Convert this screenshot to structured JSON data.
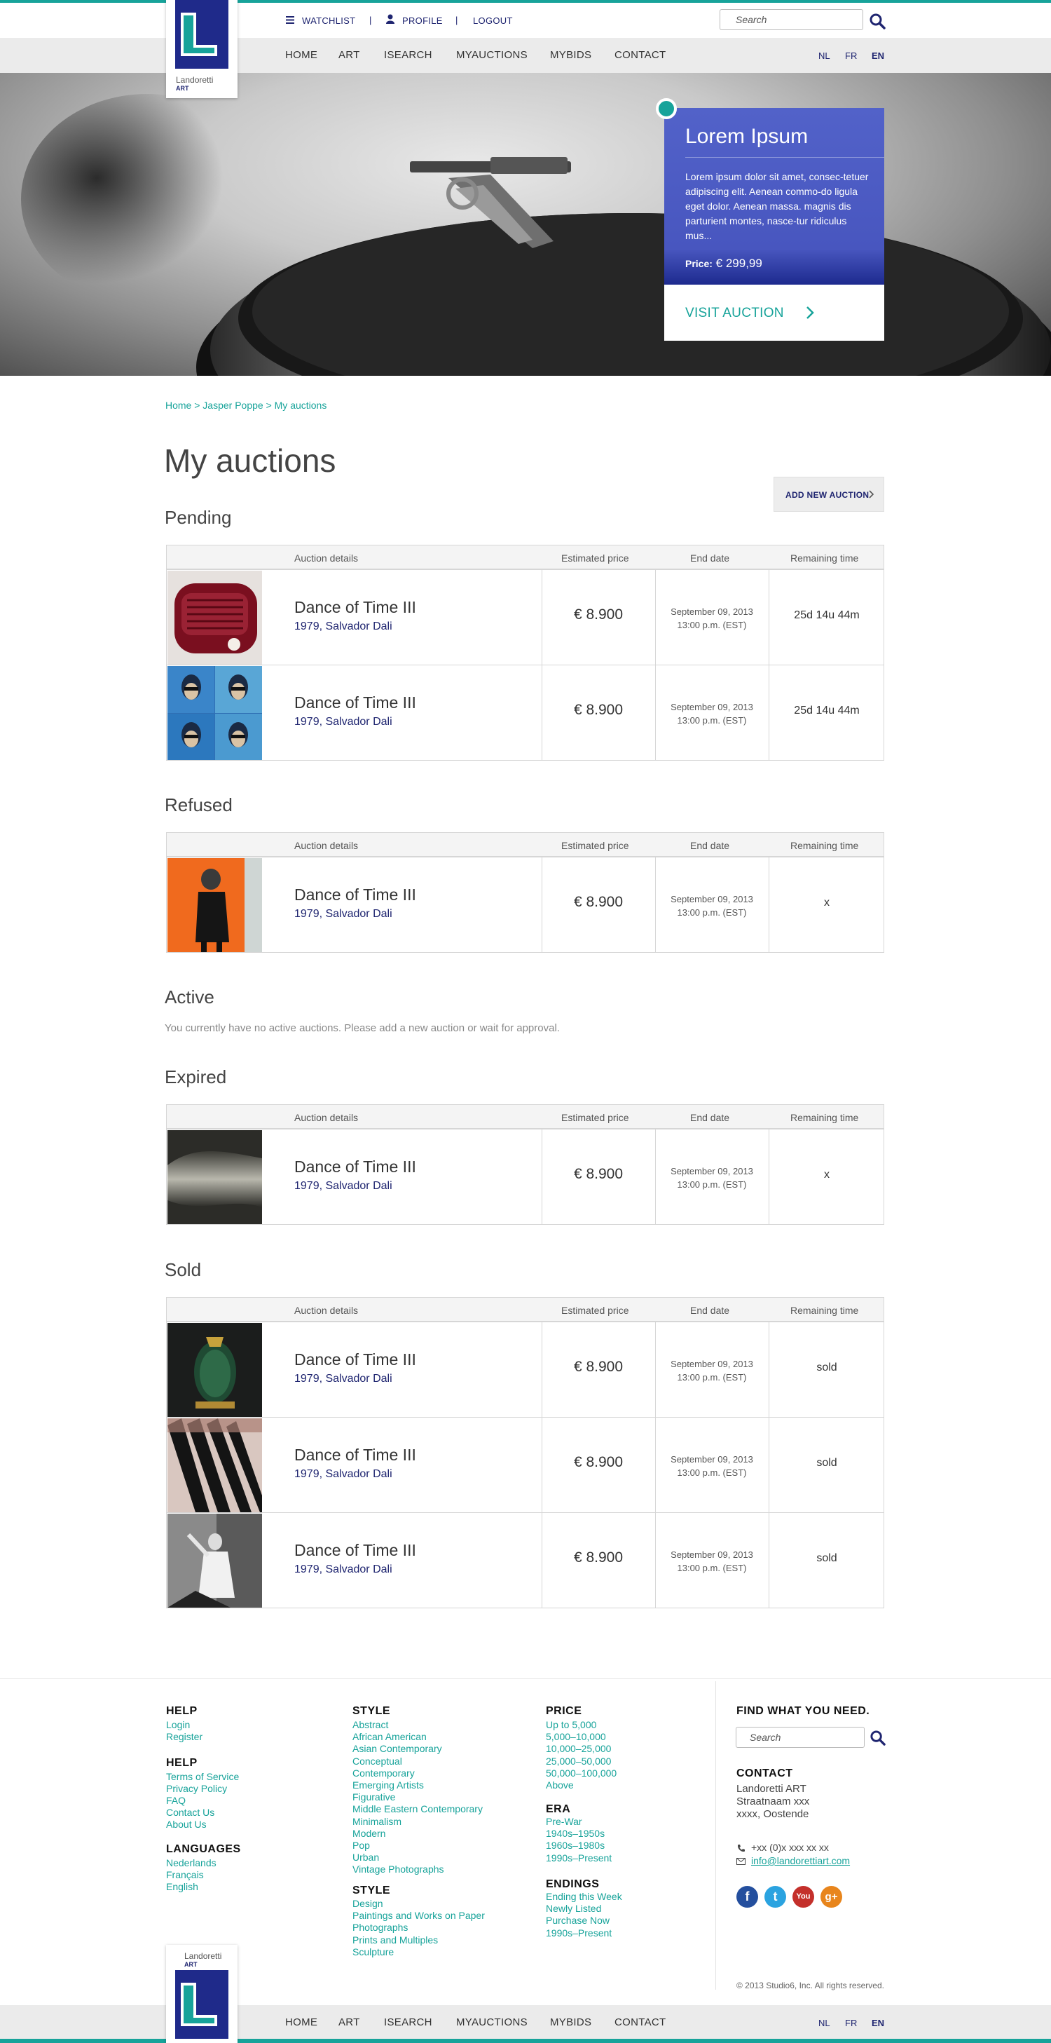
{
  "brand": {
    "name": "Landoretti",
    "sub": "ART"
  },
  "header": {
    "watchlist": "WATCHLIST",
    "profile": "PROFILE",
    "logout": "LOGOUT",
    "separator": "|",
    "search_placeholder": "Search",
    "nav": [
      "HOME",
      "ART",
      "ISEARCH",
      "MYAUCTIONS",
      "MYBIDS",
      "CONTACT"
    ],
    "languages": [
      "NL",
      "FR",
      "EN"
    ],
    "active_language": "EN"
  },
  "hero": {
    "title": "Lorem Ipsum",
    "body": "Lorem ipsum dolor sit amet, consec-tetuer adipiscing elit. Aenean commo-do ligula eget dolor. Aenean massa. magnis dis parturient montes, nasce-tur ridiculus mus...",
    "price_label": "Price:",
    "price_value": "€ 299,99",
    "cta": "VISIT AUCTION"
  },
  "breadcrumb": "Home > Jasper Poppe > My auctions",
  "page_title": "My auctions",
  "add_button": "ADD NEW AUCTION",
  "table_headers": {
    "details": "Auction details",
    "price": "Estimated price",
    "end": "End date",
    "remaining": "Remaining time"
  },
  "sections": {
    "pending": {
      "title": "Pending",
      "rows": [
        {
          "title": "Dance of Time III",
          "sub": "1979, Salvador Dali",
          "price": "€ 8.900",
          "date1": "September 09, 2013",
          "date2": "13:00 p.m. (EST)",
          "remaining": "25d 14u 44m"
        },
        {
          "title": "Dance of Time III",
          "sub": "1979, Salvador Dali",
          "price": "€ 8.900",
          "date1": "September 09, 2013",
          "date2": "13:00 p.m. (EST)",
          "remaining": "25d 14u 44m"
        }
      ]
    },
    "refused": {
      "title": "Refused",
      "rows": [
        {
          "title": "Dance of Time III",
          "sub": "1979, Salvador Dali",
          "price": "€ 8.900",
          "date1": "September 09, 2013",
          "date2": "13:00 p.m. (EST)",
          "remaining": "x"
        }
      ]
    },
    "active": {
      "title": "Active",
      "empty": "You currently have no active auctions. Please add a new auction or wait for approval."
    },
    "expired": {
      "title": "Expired",
      "rows": [
        {
          "title": "Dance of Time III",
          "sub": "1979, Salvador Dali",
          "price": "€ 8.900",
          "date1": "September 09, 2013",
          "date2": "13:00 p.m. (EST)",
          "remaining": "x"
        }
      ]
    },
    "sold": {
      "title": "Sold",
      "rows": [
        {
          "title": "Dance of Time III",
          "sub": "1979, Salvador Dali",
          "price": "€ 8.900",
          "date1": "September 09, 2013",
          "date2": "13:00 p.m. (EST)",
          "remaining": "sold"
        },
        {
          "title": "Dance of Time III",
          "sub": "1979, Salvador Dali",
          "price": "€ 8.900",
          "date1": "September 09, 2013",
          "date2": "13:00 p.m. (EST)",
          "remaining": "sold"
        },
        {
          "title": "Dance of Time III",
          "sub": "1979, Salvador Dali",
          "price": "€ 8.900",
          "date1": "September 09, 2013",
          "date2": "13:00 p.m. (EST)",
          "remaining": "sold"
        }
      ]
    }
  },
  "footer": {
    "help1": {
      "title": "HELP",
      "links": [
        "Login",
        "Register"
      ]
    },
    "help2": {
      "title": "HELP",
      "links": [
        "Terms of Service",
        "Privacy Policy",
        "FAQ",
        "Contact Us",
        "About Us"
      ]
    },
    "languages": {
      "title": "LANGUAGES",
      "links": [
        "Nederlands",
        "Français",
        "English"
      ]
    },
    "style1": {
      "title": "STYLE",
      "links": [
        "Abstract",
        "African American",
        "Asian Contemporary",
        "Conceptual",
        "Contemporary",
        "Emerging Artists",
        "Figurative",
        "Middle Eastern Contemporary",
        "Minimalism",
        "Modern",
        "Pop",
        "Urban",
        "Vintage Photographs"
      ]
    },
    "style2": {
      "title": "STYLE",
      "links": [
        "Design",
        "Paintings and Works on Paper",
        "Photographs",
        "Prints and Multiples",
        "Sculpture"
      ]
    },
    "price": {
      "title": "PRICE",
      "links": [
        "Up to 5,000",
        "5,000–10,000",
        "10,000–25,000",
        "25,000–50,000",
        "50,000–100,000",
        "Above"
      ]
    },
    "era": {
      "title": "ERA",
      "links": [
        "Pre-War",
        "1940s–1950s",
        "1960s–1980s",
        "1990s–Present"
      ]
    },
    "endings": {
      "title": "ENDINGS",
      "links": [
        "Ending this Week",
        "Newly Listed",
        "Purchase Now",
        "1990s–Present"
      ]
    },
    "find_title": "FIND WHAT YOU NEED.",
    "search_placeholder": "Search",
    "contact_title": "CONTACT",
    "contact_lines": [
      "Landoretti ART",
      "Straatnaam xxx",
      "xxxx, Oostende"
    ],
    "phone": "+xx (0)x xxx xx xx",
    "email": "info@landorettiart.com",
    "social": [
      "f",
      "t",
      "You",
      "g+"
    ],
    "copyright": "© 2013 Studio6, Inc. All rights reserved."
  },
  "colors": {
    "accent": "#17a39a",
    "navy": "#1f2570",
    "hero_card": "#4856bf"
  }
}
